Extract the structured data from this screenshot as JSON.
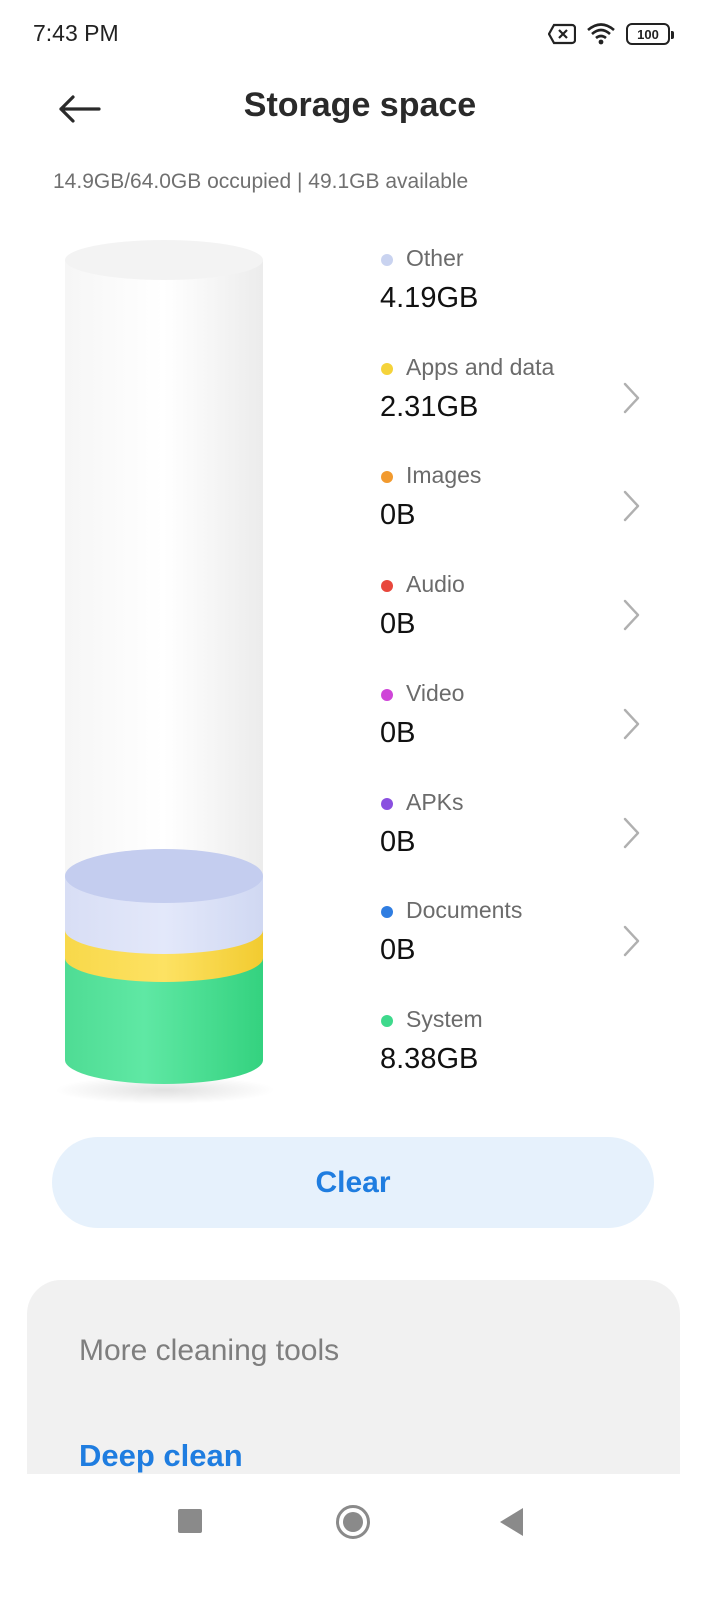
{
  "status_bar": {
    "time": "7:43 PM",
    "battery": "100",
    "icons": [
      "sim-no-signal-icon",
      "wifi-icon",
      "battery-icon"
    ]
  },
  "header": {
    "title": "Storage space",
    "back_icon": "arrow-left-icon"
  },
  "summary": "14.9GB/64.0GB occupied | 49.1GB available",
  "storage": {
    "total_gb": 64.0,
    "used_gb": 14.9,
    "available_gb": 49.1
  },
  "categories": [
    {
      "label": "Other",
      "value": "4.19GB",
      "color": "#c9d3f0",
      "has_chevron": false
    },
    {
      "label": "Apps and data",
      "value": "2.31GB",
      "color": "#f5d33a",
      "has_chevron": true
    },
    {
      "label": "Images",
      "value": "0B",
      "color": "#f29a2e",
      "has_chevron": true
    },
    {
      "label": "Audio",
      "value": "0B",
      "color": "#e8473c",
      "has_chevron": true
    },
    {
      "label": "Video",
      "value": "0B",
      "color": "#cf45d8",
      "has_chevron": true
    },
    {
      "label": "APKs",
      "value": "0B",
      "color": "#8a4fe0",
      "has_chevron": true
    },
    {
      "label": "Documents",
      "value": "0B",
      "color": "#2f7de1",
      "has_chevron": true
    },
    {
      "label": "System",
      "value": "8.38GB",
      "color": "#3ed98c",
      "has_chevron": false
    }
  ],
  "clear_button": "Clear",
  "tools": {
    "title": "More cleaning tools",
    "deep_clean": "Deep clean"
  },
  "nav": {
    "recents_icon": "square-icon",
    "home_icon": "circle-home-icon",
    "back_icon": "triangle-back-icon"
  },
  "colors": {
    "accent": "#1f7de0",
    "clear_bg": "#e6f1fc",
    "card_bg": "#f1f1f1"
  }
}
